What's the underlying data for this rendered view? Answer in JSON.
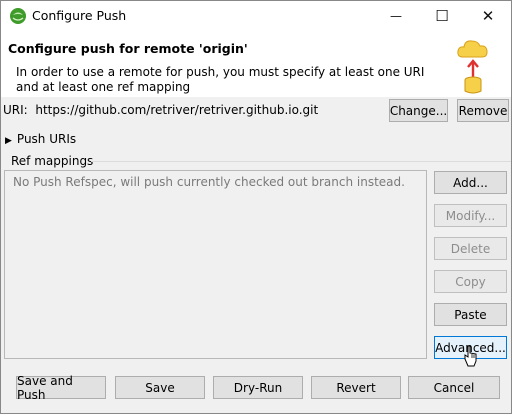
{
  "window": {
    "title": "Configure Push",
    "minimize_glyph": "—",
    "maximize_glyph": "☐",
    "close_glyph": "✕",
    "app_icon": "eclipse-icon"
  },
  "banner": {
    "title": "Configure push for remote 'origin'",
    "message": "In order to use a remote for push, you must specify at least one URI and at least one ref mapping",
    "icon": "cloud-upload-database-icon"
  },
  "uri": {
    "label": "URI:",
    "value": "https://github.com/retriver/retriver.github.io.git",
    "change_label": "Change...",
    "remove_label": "Remove"
  },
  "push_uris": {
    "label": "Push URIs",
    "expanded": false
  },
  "ref_mappings": {
    "label": "Ref mappings",
    "empty_hint": "No Push Refspec, will push currently checked out branch instead.",
    "buttons": {
      "add": "Add...",
      "modify": "Modify...",
      "delete": "Delete",
      "copy": "Copy",
      "paste": "Paste",
      "advanced": "Advanced..."
    }
  },
  "footer": {
    "save_and_push": "Save and Push",
    "save": "Save",
    "dry_run": "Dry-Run",
    "revert": "Revert",
    "cancel": "Cancel"
  },
  "colors": {
    "window_bg": "#f0f0f0",
    "button_bg": "#e1e1e1",
    "focus_border": "#0078d7",
    "disabled_text": "#8d8d8d"
  }
}
